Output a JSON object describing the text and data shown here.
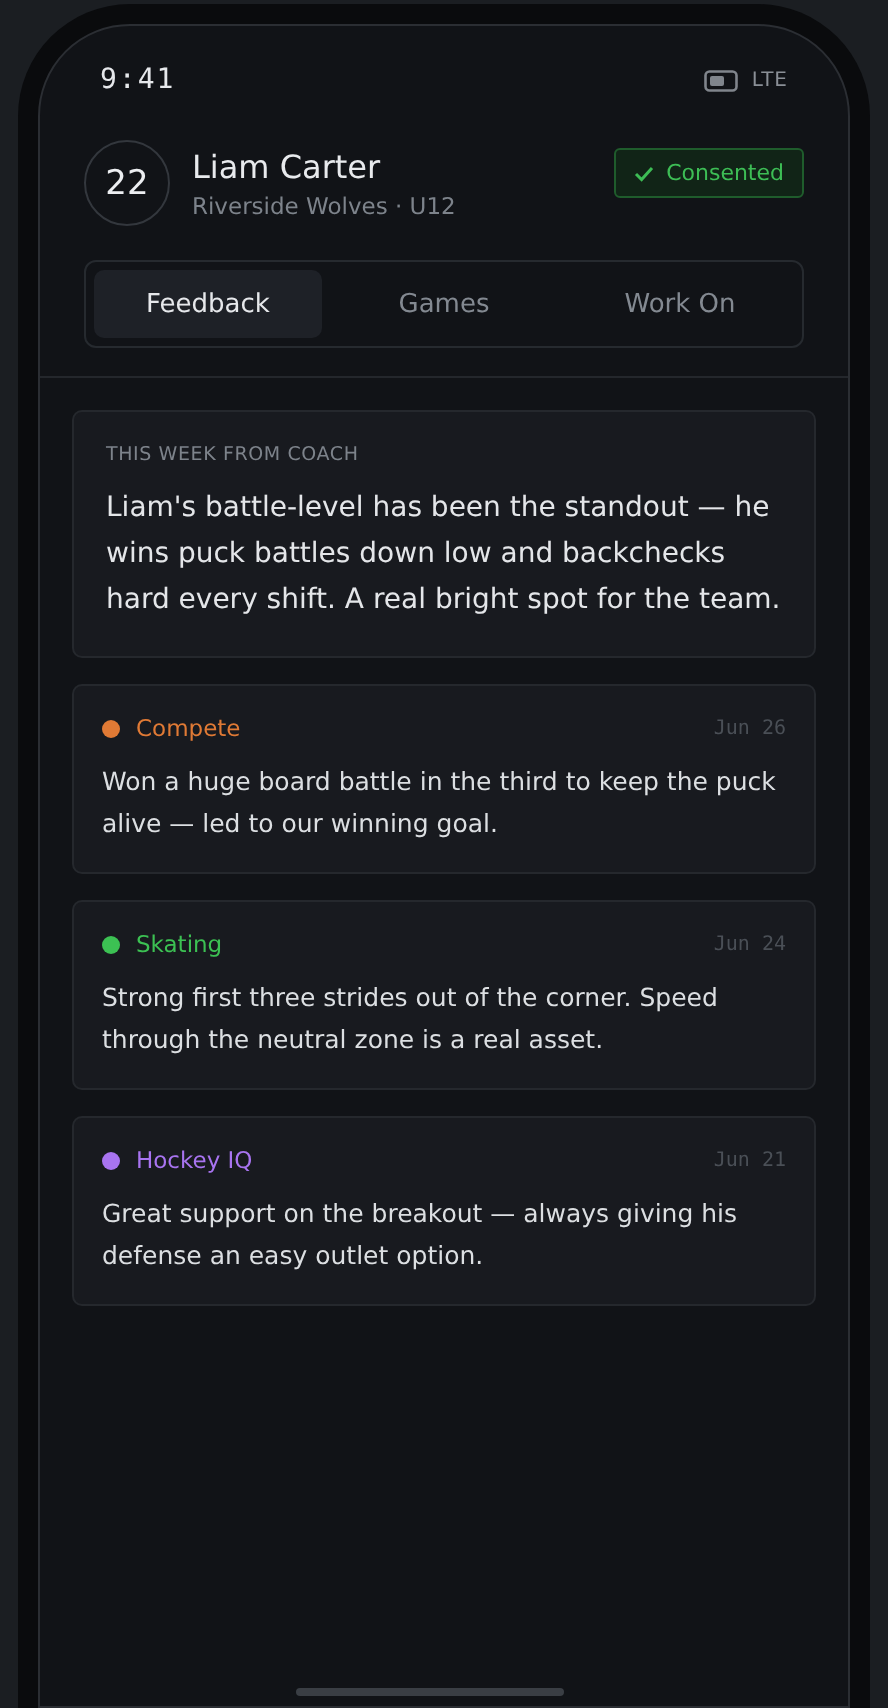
{
  "status_bar": {
    "time": "9:41",
    "network": "LTE"
  },
  "player": {
    "number": "22",
    "name": "Liam Carter",
    "team": "Riverside Wolves · U12",
    "badge": "Consented"
  },
  "tabs": [
    {
      "label": "Feedback",
      "selected": true
    },
    {
      "label": "Games",
      "selected": false
    },
    {
      "label": "Work On",
      "selected": false
    }
  ],
  "summary": {
    "heading": "THIS WEEK FROM COACH",
    "text": "Liam's battle-level has been the standout — he wins puck battles down low and backchecks hard every shift. A real bright spot for the team."
  },
  "notes": [
    {
      "category": "Compete",
      "color": "#e07a35",
      "date": "Jun 26",
      "text": "Won a huge board battle in the third to keep the puck alive — led to our winning goal."
    },
    {
      "category": "Skating",
      "color": "#3cc153",
      "date": "Jun 24",
      "text": "Strong first three strides out of the corner. Speed through the neutral zone is a real asset."
    },
    {
      "category": "Hockey IQ",
      "color": "#a874f0",
      "date": "Jun 21",
      "text": "Great support on the breakout — always giving his defense an easy outlet option."
    }
  ]
}
